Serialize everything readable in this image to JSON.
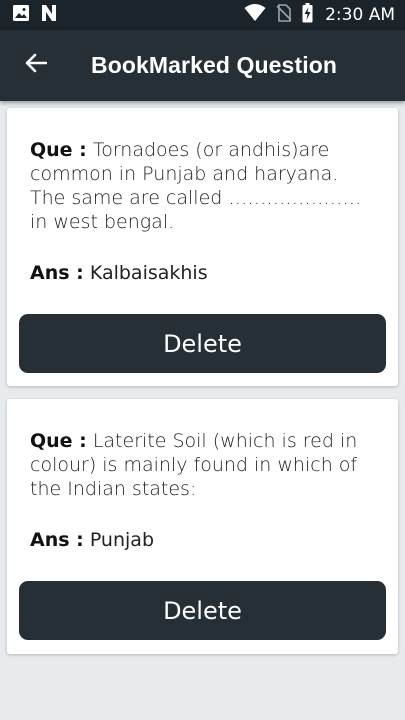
{
  "status_bar": {
    "time": "2:30 AM",
    "icons": [
      "image-icon",
      "n-logo-icon",
      "wifi-icon",
      "no-sim-icon",
      "battery-charging-icon"
    ]
  },
  "app_bar": {
    "title": "BookMarked Question",
    "back_icon": "arrow-left-icon"
  },
  "labels": {
    "question_prefix": "Que :",
    "answer_prefix": "Ans :",
    "delete": "Delete"
  },
  "questions": [
    {
      "question": "Tornadoes (or andhis)are common in Punjab and haryana. The same are called ………………… in west bengal.",
      "answer": "Kalbaisakhis"
    },
    {
      "question": "Laterite Soil (which is red in colour) is mainly found in which of the Indian states:",
      "answer": "Punjab"
    }
  ],
  "colors": {
    "app_bar": "#262f36",
    "status_bar": "#1c242b",
    "background": "#e8ebee",
    "button": "#262f36"
  }
}
